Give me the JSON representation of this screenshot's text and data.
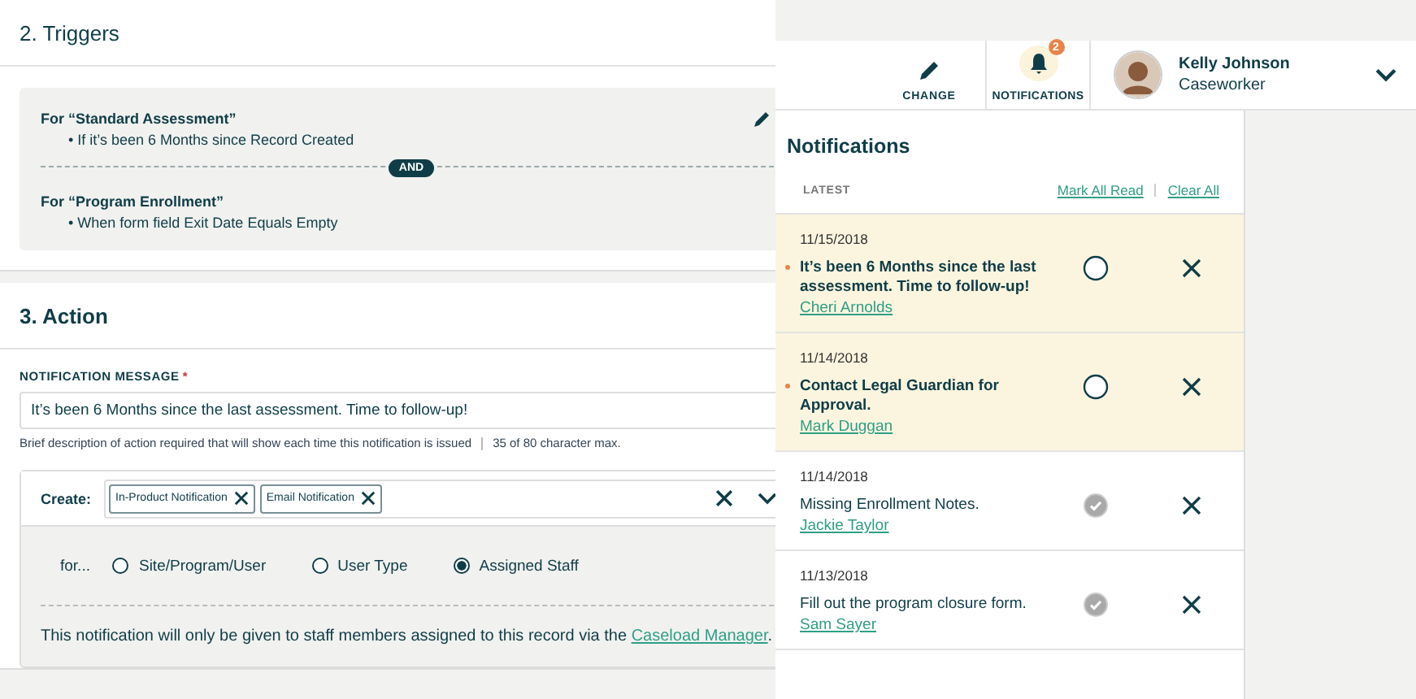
{
  "triggers": {
    "title": "2. Triggers",
    "groups": [
      {
        "heading": "For “Standard Assessment”",
        "condition": "• If it’s been 6 Months since Record Created"
      },
      {
        "heading": "For “Program Enrollment”",
        "condition": "• When form field Exit Date Equals Empty"
      }
    ],
    "joiner": "AND"
  },
  "action": {
    "title": "3. Action",
    "message_label": "NOTIFICATION MESSAGE",
    "required_mark": "*",
    "message": "It’s been 6 Months since the last assessment. Time to follow-up!",
    "hint": "Brief description of action required that will show each time this notification is issued",
    "count": "35 of 80 character max.",
    "create_label": "Create:",
    "create_tags": [
      "In-Product Notification",
      "Email Notification"
    ],
    "for_label": "for...",
    "recipients": [
      {
        "label": "Site/Program/User",
        "selected": false
      },
      {
        "label": "User Type",
        "selected": false
      },
      {
        "label": "Assigned Staff",
        "selected": true
      }
    ],
    "note": "This notification will only be given to staff members assigned to this record via the",
    "note_link": "Caseload Manager",
    "note_end": "."
  },
  "header": {
    "change": "CHANGE",
    "notifications": "NOTIFICATIONS",
    "badge": "2",
    "user_name": "Kelly Johnson",
    "user_role": "Caseworker"
  },
  "notifications": {
    "title": "Notifications",
    "section": "LATEST",
    "mark_all": "Mark All Read",
    "clear_all": "Clear All",
    "items": [
      {
        "date": "11/15/2018",
        "text": "It’s been 6 Months since the last assessment. Time to follow-up!",
        "person": "Cheri Arnolds",
        "read": false
      },
      {
        "date": "11/14/2018",
        "text": "Contact Legal Guardian for Approval.",
        "person": "Mark Duggan",
        "read": false
      },
      {
        "date": "11/14/2018",
        "text": "Missing Enrollment Notes.",
        "person": "Jackie Taylor",
        "read": true
      },
      {
        "date": "11/13/2018",
        "text": "Fill out the program closure form.",
        "person": "Sam Sayer",
        "read": true
      }
    ]
  }
}
